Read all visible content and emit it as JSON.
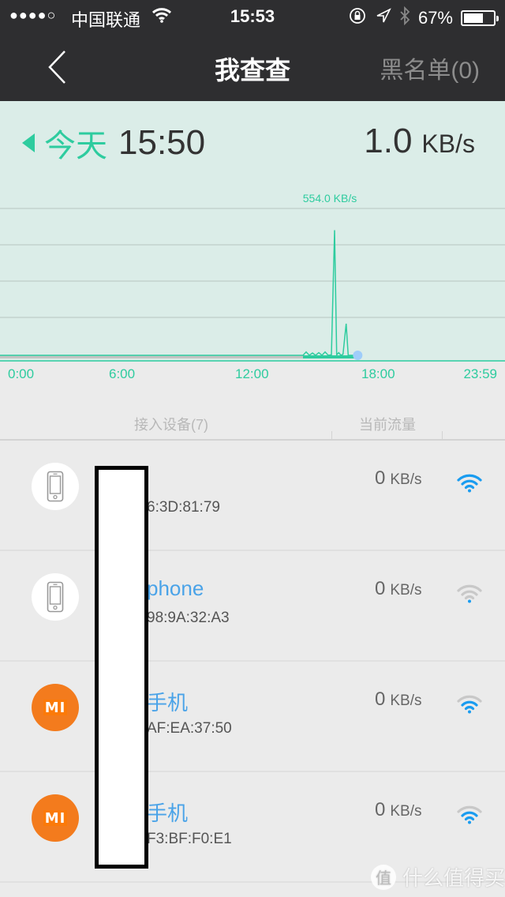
{
  "status_bar": {
    "signal": "●●●●○",
    "carrier": "中国联通",
    "time": "15:53",
    "battery_percent": "67%",
    "battery_level": 0.67
  },
  "nav": {
    "back_icon": "chevron-left-icon",
    "title": "我查查",
    "blacklist": "黑名单(0)"
  },
  "summary": {
    "day": "今天",
    "time": "15:50",
    "rate_value": "1.0",
    "rate_unit": "KB/s"
  },
  "chart_data": {
    "type": "line",
    "title": "",
    "xlabel": "",
    "ylabel": "",
    "x_tick_labels": [
      "0:00",
      "6:00",
      "12:00",
      "18:00",
      "23:59"
    ],
    "x_range_hours": [
      0,
      24
    ],
    "y_range_kbs": [
      0,
      650
    ],
    "grid": true,
    "peak_label": "554.0 KB/s",
    "accent_color": "#2ecc9f",
    "series": [
      {
        "name": "traffic",
        "x_hours": [
          0,
          14.4,
          14.55,
          14.7,
          14.85,
          15.0,
          15.15,
          15.3,
          15.45,
          15.6,
          15.75,
          15.9,
          16.0,
          16.1,
          16.2,
          16.3,
          16.45,
          16.55,
          16.65,
          16.8,
          16.95,
          17.0
        ],
        "y_kbs": [
          0,
          0,
          15,
          0,
          10,
          0,
          12,
          0,
          15,
          0,
          2,
          554,
          2,
          12,
          0,
          5,
          140,
          0,
          0,
          0,
          0,
          0
        ]
      }
    ],
    "elapsed_until_hours": 14.4,
    "current_marker_hours": 17.0
  },
  "list": {
    "header_devices": "接入设备(7)",
    "header_traffic": "当前流量",
    "devices": [
      {
        "icon": "phone-icon",
        "name": "",
        "mac": "6:3D:81:79",
        "speed": "0",
        "unit": "KB/s",
        "signal_level": 4
      },
      {
        "icon": "phone-icon",
        "name": "phone",
        "mac": "98:9A:32:A3",
        "speed": "0",
        "unit": "KB/s",
        "signal_level": 1
      },
      {
        "icon": "xiaomi-logo-icon",
        "name": "手机",
        "mac": "AF:EA:37:50",
        "speed": "0",
        "unit": "KB/s",
        "signal_level": 3
      },
      {
        "icon": "xiaomi-logo-icon",
        "name": "手机",
        "mac": "F3:BF:F0:E1",
        "speed": "0",
        "unit": "KB/s",
        "signal_level": 3
      }
    ]
  },
  "watermark": {
    "icon_char": "值",
    "text": "什么值得买"
  },
  "colors": {
    "accent": "#2ecc9f",
    "link_blue": "#4aa3e8",
    "wifi_blue": "#1a9cf0",
    "xiaomi_orange": "#f37b1d"
  }
}
